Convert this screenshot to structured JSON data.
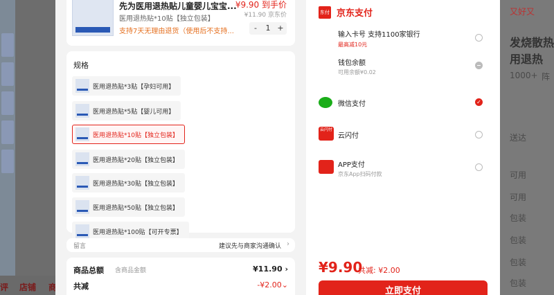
{
  "product": {
    "name": "先为医用退热贴儿童婴儿宝宝...",
    "spec": "医用退热贴*10贴【独立包装】",
    "return_policy": "支持7天无理由退货（使用后不支持...",
    "price": "¥9.90 到手价",
    "original_price": "¥11.90 京东价",
    "quantity": "1",
    "minus": "-",
    "plus": "+"
  },
  "spec_section": {
    "title": "规格",
    "items": [
      {
        "label": "医用退热贴*3贴【孕妇可用】"
      },
      {
        "label": "医用退热贴*5贴【婴儿可用】"
      },
      {
        "label": "医用退热贴*10贴【独立包装】"
      },
      {
        "label": "医用退热贴*20贴【独立包装】"
      },
      {
        "label": "医用退热贴*30贴【独立包装】"
      },
      {
        "label": "医用退热贴*50贴【独立包装】"
      },
      {
        "label": "医用退热贴*100贴【可开专票】"
      }
    ],
    "selected_index": 2
  },
  "note": {
    "label": "留言",
    "value": "建议先与商家沟通确认"
  },
  "totals": {
    "label": "商品总额",
    "sub": "含商品金额",
    "value": "¥11.90",
    "discount_label": "共减",
    "discount_value": "-¥2.00"
  },
  "payment": {
    "logo_text": "东付",
    "title": "京东支付",
    "options": [
      {
        "label": "输入卡号 支持1100家银行",
        "sub": "最高减10元",
        "state": "unchecked"
      },
      {
        "label": "钱包余额",
        "sub": "可用余额¥0.02",
        "state": "disabled"
      },
      {
        "label": "微信支付",
        "sub": "",
        "state": "checked"
      },
      {
        "label": "云闪付",
        "sub": "",
        "state": "unchecked"
      },
      {
        "label": "APP支付",
        "sub": "京东App扫码付款",
        "state": "unchecked"
      }
    ],
    "upay_icon_text": "云闪付",
    "final_price": "¥9.90",
    "final_discount": "共减: ¥2.00",
    "button_label": "立即支付"
  },
  "background": {
    "bottom_nav": [
      "评",
      "店铺",
      "商"
    ],
    "right_texts": [
      "又好又",
      "发烧散热",
      "用退热",
      "1000+",
      "阵",
      "送达",
      "可用",
      "可用",
      "包装",
      "包装",
      "包装",
      "包装",
      "包装",
      "包装"
    ]
  },
  "colors": {
    "accent": "#e2231a",
    "wechat": "#1aad19",
    "warning": "#e57020"
  }
}
